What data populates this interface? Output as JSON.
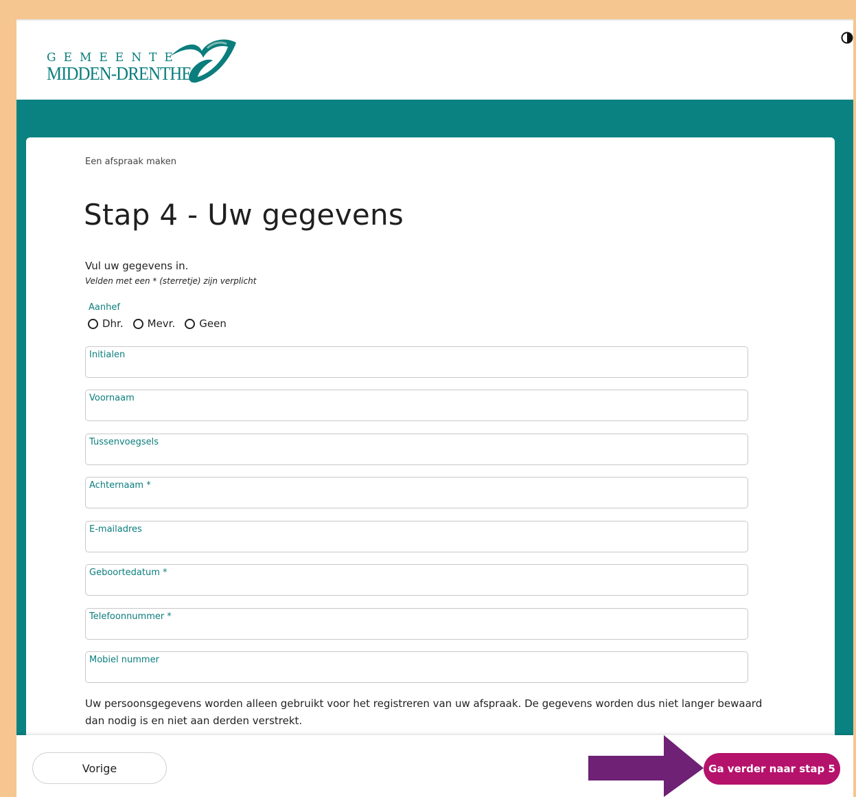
{
  "header": {
    "logo_line1": "GEMEENTE",
    "logo_line2": "MIDDEN-DRENTHE",
    "contrast_icon": "contrast-icon"
  },
  "colors": {
    "teal": "#0b8282",
    "brand_text": "#0b7d7d",
    "primary_button": "#b5126c",
    "arrow": "#6e2175",
    "outer_border": "#f5c690"
  },
  "page": {
    "breadcrumb": "Een afspraak maken",
    "title": "Stap 4 - Uw gegevens",
    "intro": "Vul uw gegevens in.",
    "required_note": "Velden met een * (sterretje) zijn verplicht"
  },
  "salutation": {
    "label": "Aanhef",
    "options": [
      "Dhr.",
      "Mevr.",
      "Geen"
    ]
  },
  "fields": [
    {
      "label": "Initialen",
      "value": ""
    },
    {
      "label": "Voornaam",
      "value": ""
    },
    {
      "label": "Tussenvoegsels",
      "value": ""
    },
    {
      "label": "Achternaam *",
      "value": ""
    },
    {
      "label": "E-mailadres",
      "value": ""
    },
    {
      "label": "Geboortedatum *",
      "value": ""
    },
    {
      "label": "Telefoonnummer *",
      "value": ""
    },
    {
      "label": "Mobiel nummer",
      "value": ""
    }
  ],
  "privacy_text": "Uw persoonsgegevens worden alleen gebruikt voor het registreren van uw afspraak. De gegevens worden dus niet langer bewaard dan nodig is en niet aan derden verstrekt.",
  "footer": {
    "prev_label": "Vorige",
    "next_label": "Ga verder naar stap 5"
  }
}
